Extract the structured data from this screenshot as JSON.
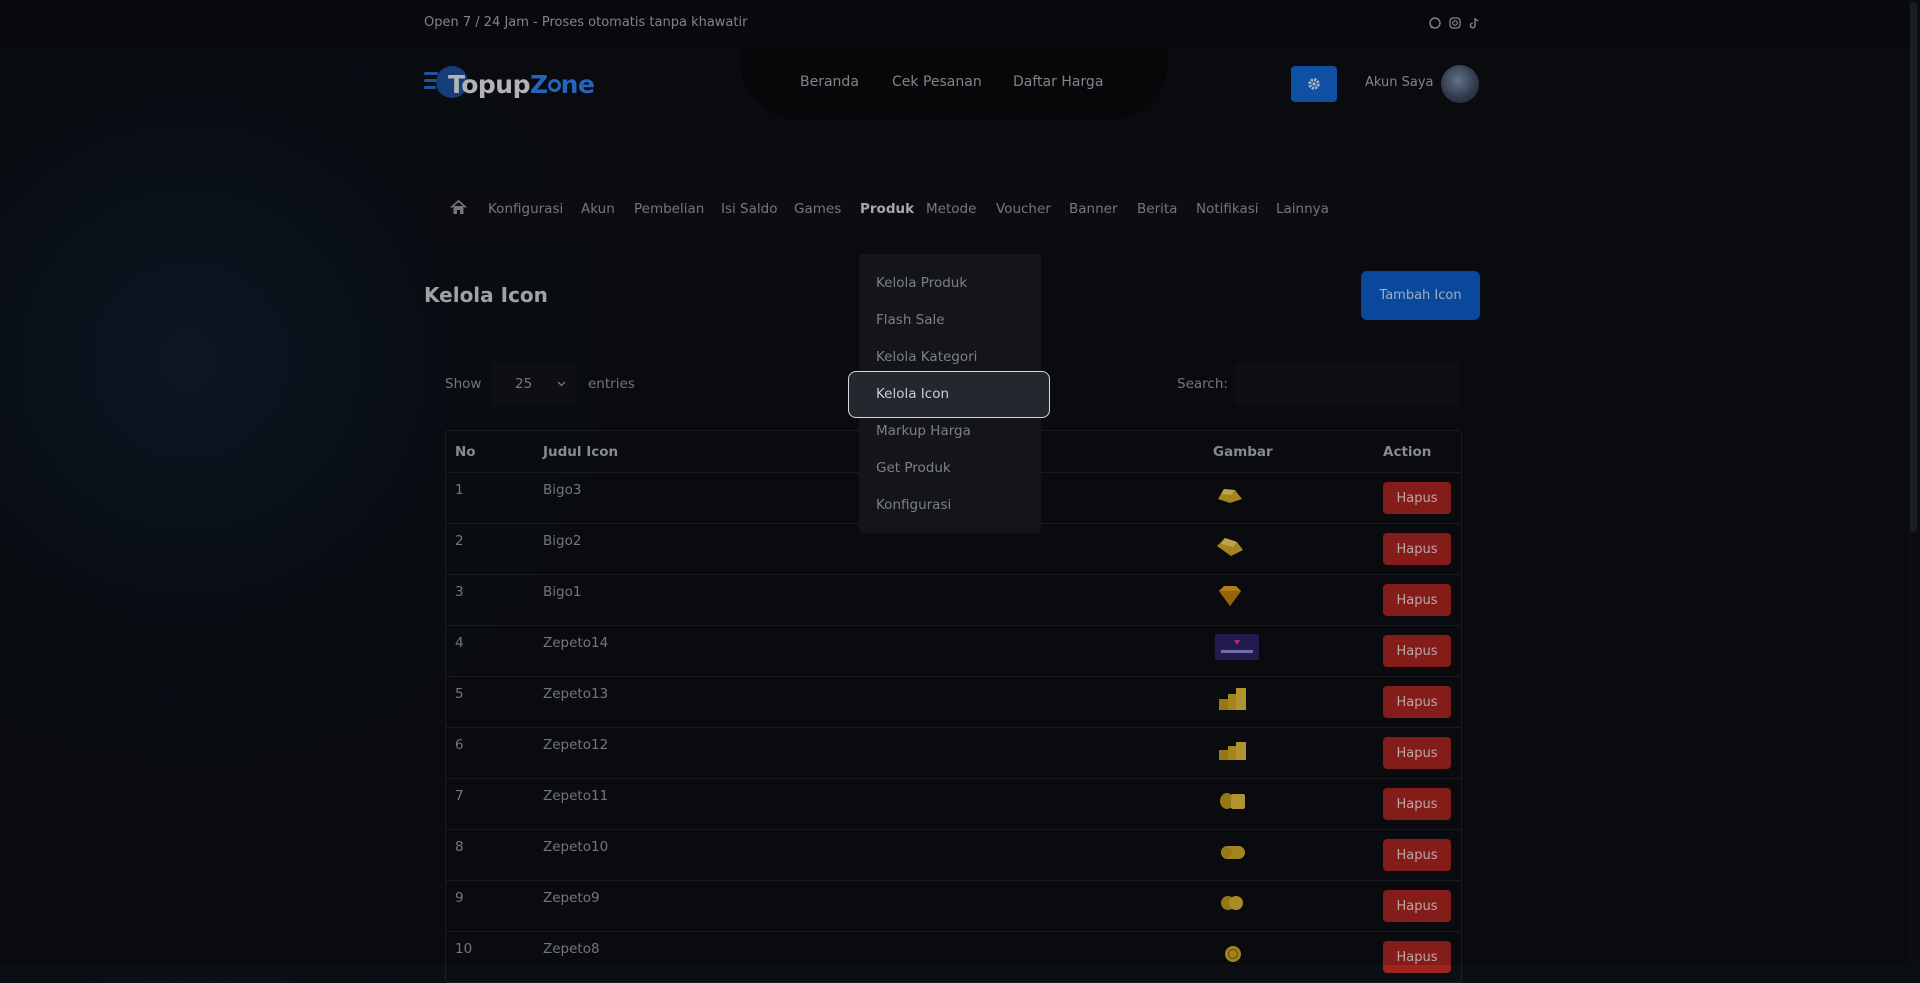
{
  "topbar": {
    "text": "Open 7 / 24 Jam - Proses otomatis tanpa khawatir",
    "social_icons": [
      "whatsapp-icon",
      "instagram-icon",
      "tiktok-icon"
    ]
  },
  "logo": {
    "part1": "Topup",
    "part2": "Z",
    "part3": "ne"
  },
  "nav": {
    "beranda": "Beranda",
    "cek_pesanan": "Cek Pesanan",
    "daftar_harga": "Daftar Harga"
  },
  "header": {
    "account_label": "Akun Saya",
    "settings_icon": "gear-icon"
  },
  "menu": {
    "items": [
      "Konfigurasi",
      "Akun",
      "Pembelian",
      "Isi Saldo",
      "Games",
      "Produk",
      "Metode",
      "Voucher",
      "Banner",
      "Berita",
      "Notifikasi",
      "Lainnya"
    ],
    "active": "Produk"
  },
  "dropdown": {
    "items": [
      "Kelola Produk",
      "Flash Sale",
      "Kelola Kategori",
      "Kelola Icon",
      "Markup Harga",
      "Get Produk",
      "Konfigurasi"
    ],
    "highlighted": "Kelola Icon"
  },
  "page": {
    "title": "Kelola Icon",
    "add_button": "Tambah Icon"
  },
  "table_controls": {
    "show_label": "Show",
    "show_value": "25",
    "entries_label": "entries",
    "search_label": "Search:",
    "search_placeholder": ""
  },
  "table": {
    "headers": [
      "No",
      "Judul Icon",
      "Gambar",
      "Action"
    ],
    "rows": [
      {
        "no": "1",
        "judul": "Bigo3",
        "action": "Hapus",
        "icon": "gold-pile-icon"
      },
      {
        "no": "2",
        "judul": "Bigo2",
        "action": "Hapus",
        "icon": "gold-bars-icon"
      },
      {
        "no": "3",
        "judul": "Bigo1",
        "action": "Hapus",
        "icon": "gem-icon"
      },
      {
        "no": "4",
        "judul": "Zepeto14",
        "action": "Hapus",
        "icon": "zepeto-banner-icon"
      },
      {
        "no": "5",
        "judul": "Zepeto13",
        "action": "Hapus",
        "icon": "coin-stacks-large-icon"
      },
      {
        "no": "6",
        "judul": "Zepeto12",
        "action": "Hapus",
        "icon": "coin-stacks-icon"
      },
      {
        "no": "7",
        "judul": "Zepeto11",
        "action": "Hapus",
        "icon": "coin-stack-icon"
      },
      {
        "no": "8",
        "judul": "Zepeto10",
        "action": "Hapus",
        "icon": "coin-pair-icon"
      },
      {
        "no": "9",
        "judul": "Zepeto9",
        "action": "Hapus",
        "icon": "coin-double-icon"
      },
      {
        "no": "10",
        "judul": "Zepeto8",
        "action": "Hapus",
        "icon": "coin-icon"
      }
    ]
  },
  "colors": {
    "primary": "#0b58c0",
    "danger": "#a1231f",
    "background": "#0b0e13",
    "gold": "#c9a227"
  }
}
